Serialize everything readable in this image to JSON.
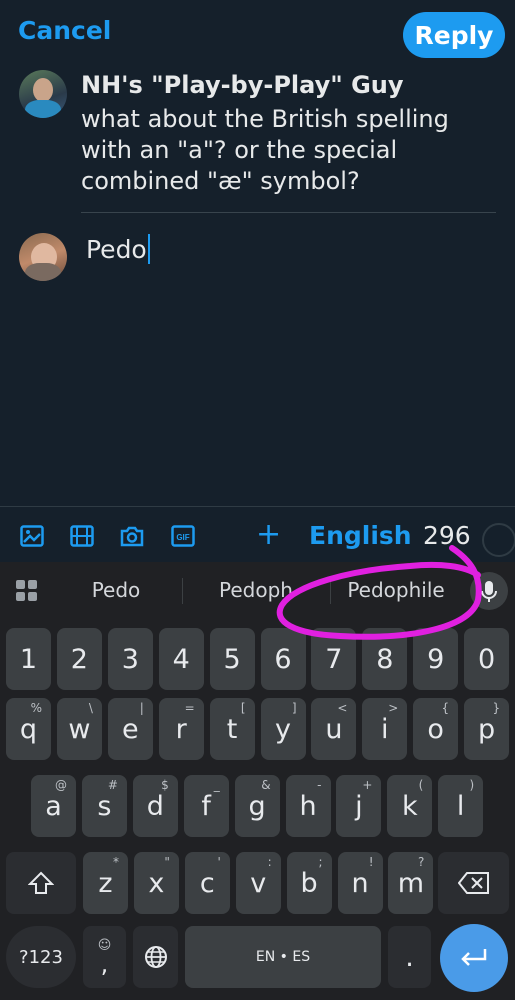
{
  "header": {
    "cancel_label": "Cancel",
    "reply_label": "Reply"
  },
  "tweet": {
    "author": "NH's \"Play-by-Play\" Guy",
    "text": "what about the British spelling with an \"a\"? or the special combined \"æ\" symbol?"
  },
  "compose": {
    "value": "Pedo"
  },
  "toolbar": {
    "icons": [
      "image-icon",
      "video-icon",
      "camera-icon",
      "gif-icon"
    ],
    "plus": "+",
    "language": "English",
    "char_count": "296"
  },
  "keyboard": {
    "suggestions": [
      "Pedo",
      "Pedoph",
      "Pedophile"
    ],
    "row_numbers": [
      "1",
      "2",
      "3",
      "4",
      "5",
      "6",
      "7",
      "8",
      "9",
      "0"
    ],
    "row1": [
      {
        "k": "q",
        "s": "%"
      },
      {
        "k": "w",
        "s": "\\"
      },
      {
        "k": "e",
        "s": "|"
      },
      {
        "k": "r",
        "s": "="
      },
      {
        "k": "t",
        "s": "["
      },
      {
        "k": "y",
        "s": "]"
      },
      {
        "k": "u",
        "s": "<"
      },
      {
        "k": "i",
        "s": ">"
      },
      {
        "k": "o",
        "s": "{"
      },
      {
        "k": "p",
        "s": "}"
      }
    ],
    "row2": [
      {
        "k": "a",
        "s": "@"
      },
      {
        "k": "s",
        "s": "#"
      },
      {
        "k": "d",
        "s": "$"
      },
      {
        "k": "f",
        "s": "_"
      },
      {
        "k": "g",
        "s": "&"
      },
      {
        "k": "h",
        "s": "-"
      },
      {
        "k": "j",
        "s": "+"
      },
      {
        "k": "k",
        "s": "("
      },
      {
        "k": "l",
        "s": ")"
      }
    ],
    "row3": [
      {
        "k": "z",
        "s": "*"
      },
      {
        "k": "x",
        "s": "\""
      },
      {
        "k": "c",
        "s": "'"
      },
      {
        "k": "v",
        "s": ":"
      },
      {
        "k": "b",
        "s": ";"
      },
      {
        "k": "n",
        "s": "!"
      },
      {
        "k": "m",
        "s": "?"
      }
    ],
    "symbols_label": "?123",
    "comma": ",",
    "space_label": "EN • ES",
    "period": "."
  },
  "colors": {
    "accent": "#1d9bf0",
    "background": "#15202b",
    "keyboard_bg": "#202124",
    "annotation": "#e020e0"
  }
}
